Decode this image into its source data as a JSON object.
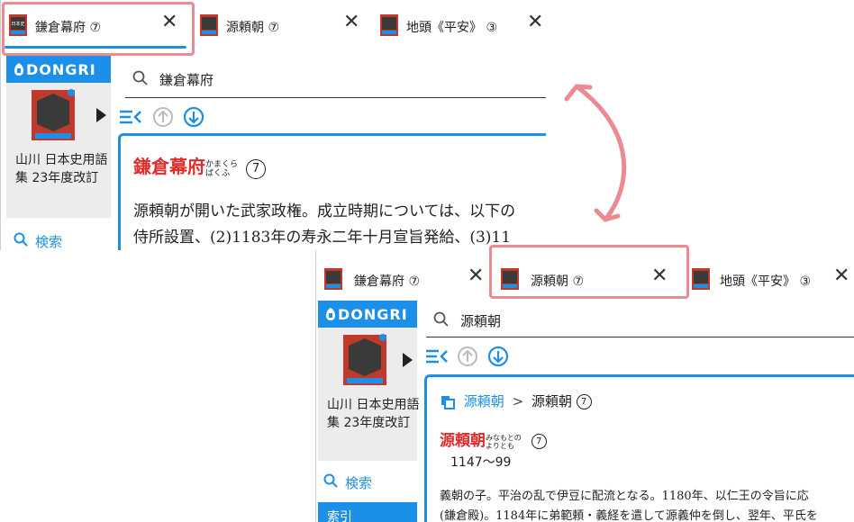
{
  "colors": {
    "accent": "#1c8fe8",
    "highlight": "#ec8a93",
    "headword_red": "#e02c2c",
    "sidebar_gray": "#ececec"
  },
  "tabs": [
    {
      "title": "鎌倉幕府",
      "count": "⑦"
    },
    {
      "title": "源頼朝",
      "count": "⑦"
    },
    {
      "title": "地頭《平安》",
      "count": "③"
    }
  ],
  "sidebar": {
    "brand": "DONGRI",
    "book_cover_text": "日本史用語集",
    "book_cover_sub": "23年度改訂",
    "book_title": "山川 日本史用語集 23年度改訂",
    "search_label": "検索",
    "next_label": "索引"
  },
  "panel_a": {
    "search_value": "鎌倉幕府",
    "headword": "鎌倉幕府",
    "ruby_top": "かまくら",
    "ruby_bottom": "ばくふ",
    "headword_count": "⑦",
    "body_line1": "源頼朝が開いた武家政権。成立時期については、以下の",
    "body_line2": "侍所設置、(2)1183年の寿永二年十月宣旨発給、(3)11"
  },
  "panel_b": {
    "search_value": "源頼朝",
    "breadcrumb_link": "源頼朝",
    "breadcrumb_sep": ">",
    "breadcrumb_current": "源頼朝",
    "breadcrumb_count": "⑦",
    "headword": "源頼朝",
    "ruby_top": "みなもとの",
    "ruby_bottom": "よりとも",
    "headword_count": "⑦",
    "years": "1147〜99",
    "body_line1": "義朝の子。平治の乱で伊豆に配流となる。1180年、以仁王の令旨に応",
    "body_line2": "(鎌倉殿)。1184年に弟範頼・義経を遣して源義仲を倒し、翌年、平氏を"
  },
  "icons": [
    "book-cover-icon",
    "close-icon",
    "search-icon",
    "toc-icon",
    "arrow-up-circle-icon",
    "arrow-down-circle-icon",
    "copy-icon",
    "play-icon",
    "bidirectional-arrow-icon",
    "dongri-logo-icon"
  ]
}
